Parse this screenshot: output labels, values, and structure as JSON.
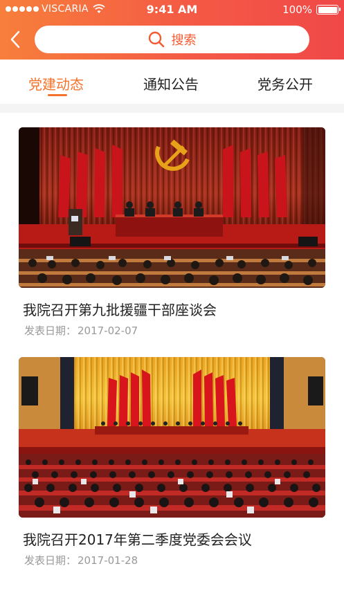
{
  "status_bar": {
    "carrier": "VISCARIA",
    "time": "9:41 AM",
    "battery": "100%"
  },
  "search": {
    "placeholder": "搜索",
    "icon": "search-icon"
  },
  "tabs": [
    {
      "label": "党建动态",
      "active": true
    },
    {
      "label": "通知公告",
      "active": false
    },
    {
      "label": "党务公开",
      "active": false
    }
  ],
  "colors": {
    "header_gradient_start": "#f77f3b",
    "header_gradient_end": "#f04848",
    "accent": "#f4732b"
  },
  "articles": [
    {
      "title": "我院召开第九批援疆干部座谈会",
      "date_label": "发表日期：",
      "date": "2017-02-07"
    },
    {
      "title": "我院召开2017年第二季度党委会会议",
      "date_label": "发表日期：",
      "date": "2017-01-28"
    }
  ]
}
